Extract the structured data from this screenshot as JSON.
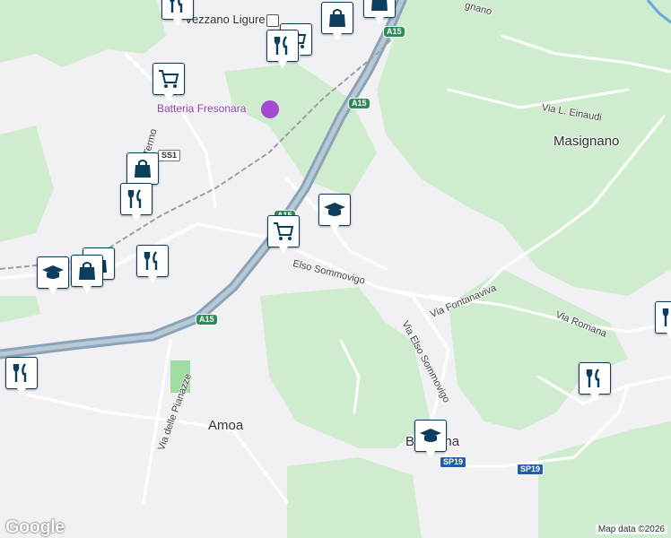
{
  "map": {
    "places": {
      "vezzano": "Vezzano Ligure",
      "masignano": "Masignano",
      "amoa": "Amoa",
      "bottagna": "Bottagna"
    },
    "poi": {
      "batteria": "Batteria Fresonara"
    },
    "streets": {
      "elso_sommovigo_1": "Elso Sommovigo",
      "elso_sommovigo_2": "Via Elso Sommovigo",
      "fontanaviva": "Via Fontanaviva",
      "romana": "Via Romana",
      "einaudi": "Via L. Einaudi",
      "pianazze": "Via delle Pianazze",
      "termo": "Termo",
      "gnano": "gnano"
    },
    "shields": {
      "a15_1": "A15",
      "a15_2": "A15",
      "a15_3": "A15",
      "a15_4": "A15",
      "ss1": "SS1",
      "sp19_1": "SP19",
      "sp19_2": "SP19"
    },
    "markers": [
      {
        "id": "shopping-cart-marker-1",
        "icon": "shopping-cart-icon"
      },
      {
        "id": "shopping-bag-marker-1",
        "icon": "shopping-bag-icon"
      },
      {
        "id": "restaurant-marker-1",
        "icon": "restaurant-icon"
      },
      {
        "id": "school-marker-1",
        "icon": "school-icon"
      }
    ],
    "branding": {
      "logo": "Google",
      "attribution": "Map data ©2026"
    },
    "colors": {
      "background": "#f1f0f3",
      "green": "#cfeccf",
      "road": "#ffffff",
      "highway": "#8aa3b8",
      "marker_border": "#0b3e5c",
      "poi_purple": "#a34bd1"
    }
  }
}
